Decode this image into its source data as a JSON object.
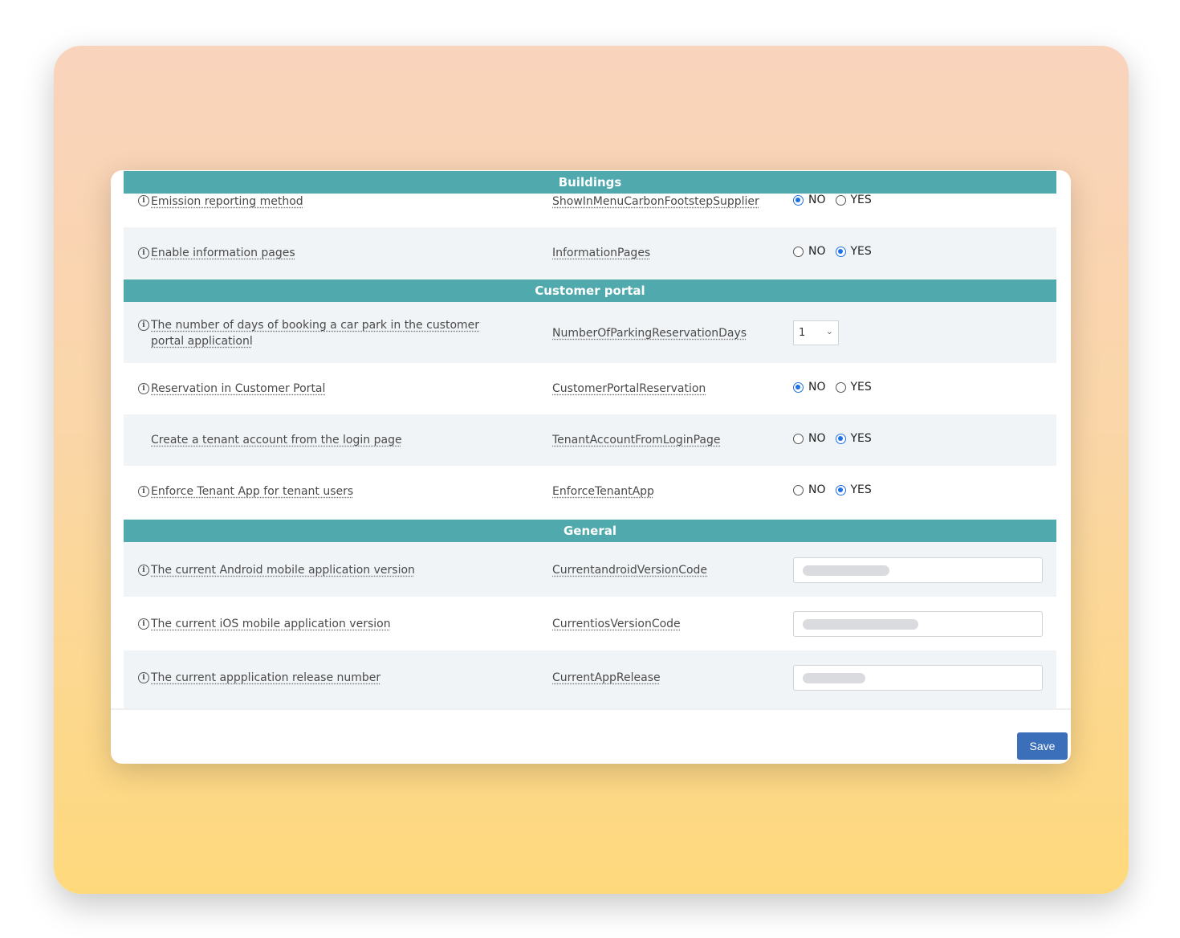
{
  "sections": {
    "buildings": {
      "title": "Buildings",
      "rows": [
        {
          "label": "Emission reporting method",
          "key": "ShowInMenuCarbonFootstepSupplier",
          "no": "NO",
          "yes": "YES",
          "selected": "NO"
        },
        {
          "label": "Enable information pages",
          "key": "InformationPages",
          "no": "NO",
          "yes": "YES",
          "selected": "YES"
        }
      ]
    },
    "customer_portal": {
      "title": "Customer portal",
      "rows": [
        {
          "label": "The number of days of booking a car park in the customer portal applicationl",
          "key": "NumberOfParkingReservationDays",
          "value": "1"
        },
        {
          "label": "Reservation in Customer Portal",
          "key": "CustomerPortalReservation",
          "no": "NO",
          "yes": "YES",
          "selected": "NO"
        },
        {
          "label": "Create a tenant account from the login page",
          "key": "TenantAccountFromLoginPage",
          "no": "NO",
          "yes": "YES",
          "selected": "YES"
        },
        {
          "label": "Enforce Tenant App for tenant users",
          "key": "EnforceTenantApp",
          "no": "NO",
          "yes": "YES",
          "selected": "YES"
        }
      ]
    },
    "general": {
      "title": "General",
      "rows": [
        {
          "label": "The current Android mobile application version",
          "key": "CurrentandroidVersionCode"
        },
        {
          "label": "The current iOS mobile application version",
          "key": "CurrentiosVersionCode"
        },
        {
          "label": "The current appplication release number",
          "key": "CurrentAppRelease"
        }
      ]
    }
  },
  "icons": {
    "info": "info-circle-icon",
    "dropdown": "chevron-down-icon"
  },
  "colors": {
    "section_header": "#50a9ac",
    "radio_checked": "#1f6fe5",
    "save_button": "#3b6fba"
  },
  "footer": {
    "save_label": "Save"
  }
}
